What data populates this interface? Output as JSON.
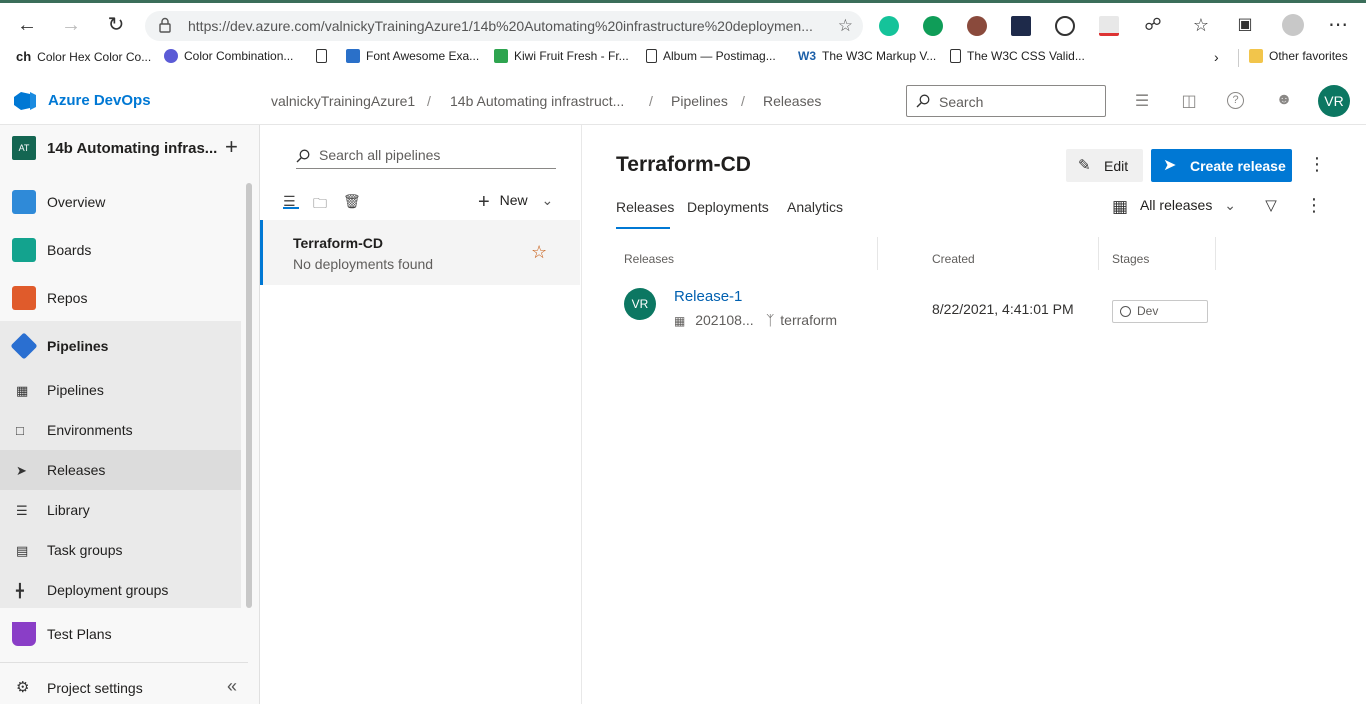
{
  "browser": {
    "url": "https://dev.azure.com/valnickyTrainingAzure1/14b%20Automating%20infrastructure%20deploymen...",
    "bookmarks": [
      {
        "label": "Color Hex Color Co...",
        "icon": "ch-icon"
      },
      {
        "label": "Color Combination...",
        "icon": "color-combination-icon"
      },
      {
        "label": "Font Awesome Exa...",
        "icon": "font-awesome-icon"
      },
      {
        "label": "Kiwi Fruit Fresh - Fr...",
        "icon": "pixabay-icon"
      },
      {
        "label": "Album — Postimag...",
        "icon": "page-icon"
      },
      {
        "label": "The W3C Markup V...",
        "icon": "w3c-icon"
      },
      {
        "label": "The W3C CSS Valid...",
        "icon": "page-icon"
      }
    ],
    "ch_label": "ch",
    "other_favorites": "Other favorites"
  },
  "header": {
    "brand": "Azure DevOps",
    "breadcrumbs": [
      "valnickyTrainingAzure1",
      "14b Automating infrastruct...",
      "Pipelines",
      "Releases"
    ],
    "search_placeholder": "Search",
    "avatar": "VR"
  },
  "sidebar": {
    "project_badge": "AT",
    "project_name": "14b Automating infras...",
    "items": [
      {
        "label": "Overview"
      },
      {
        "label": "Boards"
      },
      {
        "label": "Repos"
      },
      {
        "label": "Pipelines"
      }
    ],
    "sub_items": [
      {
        "label": "Pipelines"
      },
      {
        "label": "Environments"
      },
      {
        "label": "Releases"
      },
      {
        "label": "Library"
      },
      {
        "label": "Task groups"
      },
      {
        "label": "Deployment groups"
      }
    ],
    "test_plans": "Test Plans",
    "project_settings": "Project settings"
  },
  "pipelines_pane": {
    "search_placeholder": "Search all pipelines",
    "new_label": "New",
    "item": {
      "name": "Terraform-CD",
      "status": "No deployments found"
    }
  },
  "main": {
    "title": "Terraform-CD",
    "edit_label": "Edit",
    "create_label": "Create release",
    "tabs": [
      {
        "label": "Releases"
      },
      {
        "label": "Deployments"
      },
      {
        "label": "Analytics"
      }
    ],
    "filter_label": "All releases",
    "columns": {
      "releases": "Releases",
      "created": "Created",
      "stages": "Stages"
    },
    "rows": [
      {
        "avatar": "VR",
        "name": "Release-1",
        "build": "202108...",
        "branch": "terraform",
        "created": "8/22/2021, 4:41:01 PM",
        "stage": "Dev"
      }
    ]
  },
  "colors": {
    "accent": "#0078d4",
    "avatar": "#0c7762",
    "selected_bg": "#eaeaea"
  }
}
